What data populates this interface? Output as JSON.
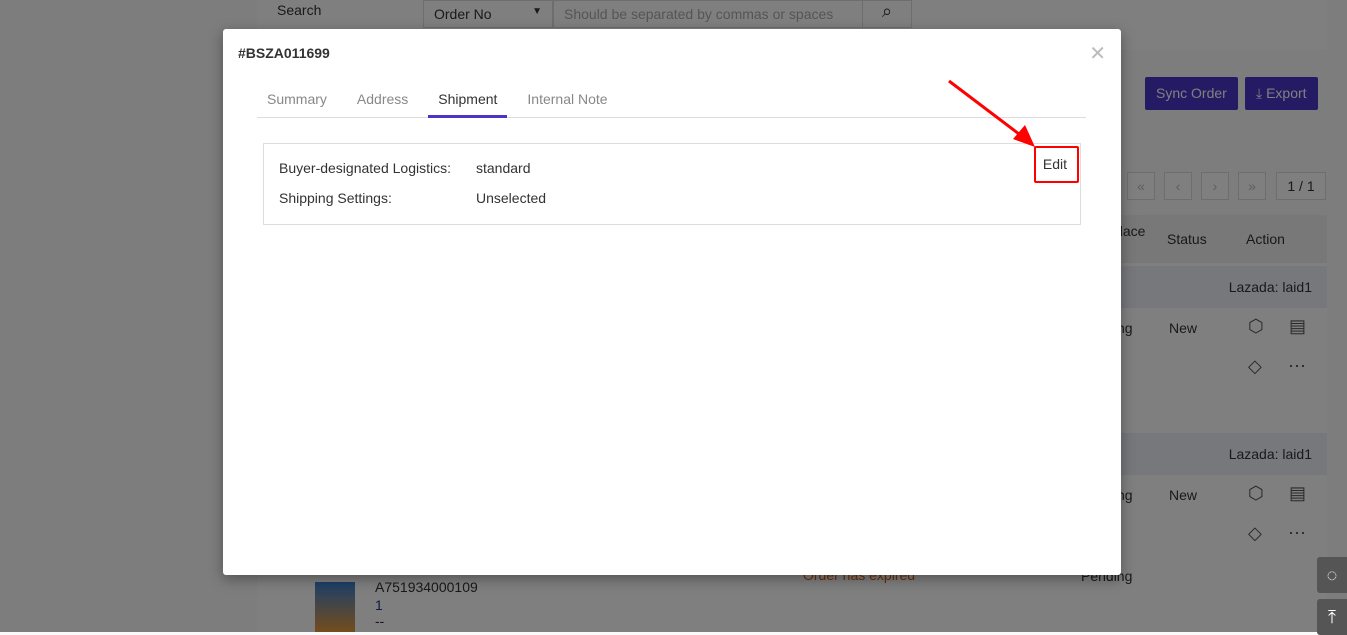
{
  "background": {
    "search_label": "Search",
    "search_type": "Order No",
    "search_placeholder": "Should be separated by commas or spaces",
    "sync_order": "Sync Order",
    "export": "Export",
    "page_indicator": "1 / 1",
    "columns": [
      "place",
      "Status",
      "Action"
    ],
    "groups": [
      {
        "store": "Lazada: laid1",
        "status": "New",
        "marketplace_status": "ng"
      },
      {
        "store": "Lazada: laid1",
        "status": "New",
        "marketplace_status": "ng"
      }
    ],
    "product_sku": "A751934000109",
    "product_qty": "1",
    "product_extra": "--",
    "expired_text": "Order has expired",
    "pending_text": "Pending"
  },
  "modal": {
    "title": "#BSZA011699",
    "tabs": [
      {
        "label": "Summary"
      },
      {
        "label": "Address"
      },
      {
        "label": "Shipment",
        "active": true
      },
      {
        "label": "Internal Note"
      }
    ],
    "shipment": {
      "logistics_label": "Buyer-designated Logistics:",
      "logistics_value": "standard",
      "settings_label": "Shipping Settings:",
      "settings_value": "Unselected",
      "edit_label": "Edit"
    }
  },
  "colors": {
    "accent": "#4b35c9",
    "highlight": "#ff0000"
  }
}
